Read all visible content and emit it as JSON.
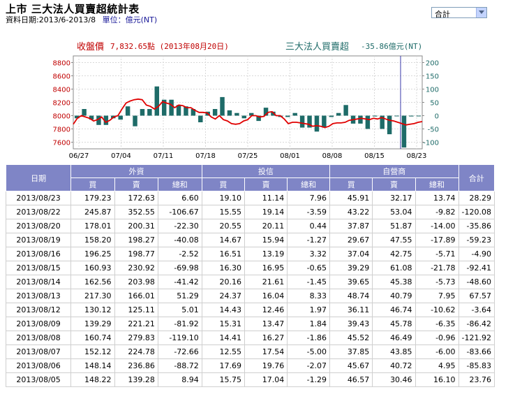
{
  "header": {
    "title": "上市 三大法人買賣超統計表",
    "date_label": "資料日期:2013/6-2013/8",
    "unit_label": "單位：億元(NT)"
  },
  "selector": {
    "selected": "合計"
  },
  "chart_data": {
    "type": "bar+line",
    "left_title": "收盤價",
    "left_value": "7,832.65點 (2013年08月20日)",
    "right_title": "三大法人買賣超",
    "right_value": "-35.86億元(NT)",
    "left_ticks": [
      "8800",
      "8600",
      "8400",
      "8200",
      "8000",
      "7800",
      "7600"
    ],
    "right_ticks": [
      "200",
      "150",
      "100",
      "50",
      "0",
      "-50",
      "-100"
    ],
    "ylim_left": [
      7500,
      8900
    ],
    "ylim_right": [
      -125,
      225
    ],
    "x_ticks": [
      "06/27",
      "07/04",
      "07/11",
      "07/18",
      "07/25",
      "08/01",
      "08/08",
      "08/15",
      "08/23"
    ],
    "bar_color": "#1e6b68",
    "line_color": "#e00000",
    "bars": [
      -10,
      25,
      -15,
      -35,
      -35,
      -10,
      -15,
      35,
      -40,
      25,
      25,
      110,
      60,
      60,
      40,
      35,
      25,
      -25,
      15,
      25,
      70,
      20,
      10,
      -10,
      10,
      -20,
      30,
      15,
      -5,
      -5,
      10,
      -45,
      -45,
      -60,
      -45,
      -5,
      10,
      40,
      -30,
      -30,
      -50,
      -3,
      -50,
      -70,
      0,
      -120,
      -3,
      0
    ],
    "line": [
      7870,
      7960,
      8000,
      7980,
      7960,
      7920,
      7940,
      7980,
      7900,
      7930,
      7980,
      8000,
      8100,
      8190,
      8220,
      8240,
      8250,
      8240,
      8160,
      8140,
      8100,
      8140,
      8210,
      8190,
      8170,
      8120,
      8160,
      8150,
      8120,
      8120,
      8080,
      8050,
      8050,
      8040,
      7980,
      7950,
      8000,
      7940,
      7920,
      7880,
      7870,
      7880,
      7920,
      7940,
      8000,
      8000,
      7980,
      7990,
      8050,
      8060,
      8000,
      8000,
      7950,
      7880,
      7900,
      7900,
      7890,
      7880,
      7870,
      7840,
      7850,
      7840,
      7820,
      7840,
      7880,
      7890,
      7890,
      7900,
      7930,
      7940,
      7950,
      7960,
      7950,
      7940,
      7960,
      7950,
      7970,
      7950,
      7930,
      7920,
      7900,
      7880,
      7860,
      7870,
      7880,
      7900,
      7910
    ]
  },
  "table": {
    "group_headers": [
      "日期",
      "外資",
      "投信",
      "自營商",
      "合計"
    ],
    "sub_headers": [
      "買",
      "賣",
      "總和",
      "買",
      "賣",
      "總和",
      "買",
      "賣",
      "總和"
    ],
    "rows": [
      [
        "2013/08/23",
        "179.23",
        "172.63",
        "6.60",
        "19.10",
        "11.14",
        "7.96",
        "45.91",
        "32.17",
        "13.74",
        "28.29"
      ],
      [
        "2013/08/22",
        "245.87",
        "352.55",
        "-106.67",
        "15.55",
        "19.14",
        "-3.59",
        "43.22",
        "53.04",
        "-9.82",
        "-120.08"
      ],
      [
        "2013/08/20",
        "178.01",
        "200.31",
        "-22.30",
        "20.55",
        "20.11",
        "0.44",
        "37.87",
        "51.87",
        "-14.00",
        "-35.86"
      ],
      [
        "2013/08/19",
        "158.20",
        "198.27",
        "-40.08",
        "14.67",
        "15.94",
        "-1.27",
        "29.67",
        "47.55",
        "-17.89",
        "-59.23"
      ],
      [
        "2013/08/16",
        "196.25",
        "198.77",
        "-2.52",
        "16.51",
        "13.19",
        "3.32",
        "37.04",
        "42.75",
        "-5.71",
        "-4.90"
      ],
      [
        "2013/08/15",
        "160.93",
        "230.92",
        "-69.98",
        "16.30",
        "16.95",
        "-0.65",
        "39.29",
        "61.08",
        "-21.78",
        "-92.41"
      ],
      [
        "2013/08/14",
        "162.56",
        "203.98",
        "-41.42",
        "20.16",
        "21.61",
        "-1.45",
        "39.65",
        "45.38",
        "-5.73",
        "-48.60"
      ],
      [
        "2013/08/13",
        "217.30",
        "166.01",
        "51.29",
        "24.37",
        "16.04",
        "8.33",
        "48.74",
        "40.79",
        "7.95",
        "67.57"
      ],
      [
        "2013/08/12",
        "130.12",
        "125.11",
        "5.01",
        "14.43",
        "12.46",
        "1.97",
        "36.11",
        "46.74",
        "-10.62",
        "-3.64"
      ],
      [
        "2013/08/09",
        "139.29",
        "221.21",
        "-81.92",
        "15.31",
        "13.47",
        "1.84",
        "39.43",
        "45.78",
        "-6.35",
        "-86.42"
      ],
      [
        "2013/08/08",
        "160.74",
        "279.83",
        "-119.10",
        "14.41",
        "16.27",
        "-1.86",
        "45.52",
        "46.49",
        "-0.96",
        "-121.92"
      ],
      [
        "2013/08/07",
        "152.12",
        "224.78",
        "-72.66",
        "12.55",
        "17.54",
        "-5.00",
        "37.85",
        "43.85",
        "-6.00",
        "-83.66"
      ],
      [
        "2013/08/06",
        "148.14",
        "236.86",
        "-88.72",
        "17.69",
        "19.76",
        "-2.07",
        "45.67",
        "40.72",
        "4.95",
        "-85.83"
      ],
      [
        "2013/08/05",
        "148.22",
        "139.28",
        "8.94",
        "15.75",
        "17.04",
        "-1.29",
        "46.57",
        "30.46",
        "16.10",
        "23.76"
      ]
    ]
  }
}
